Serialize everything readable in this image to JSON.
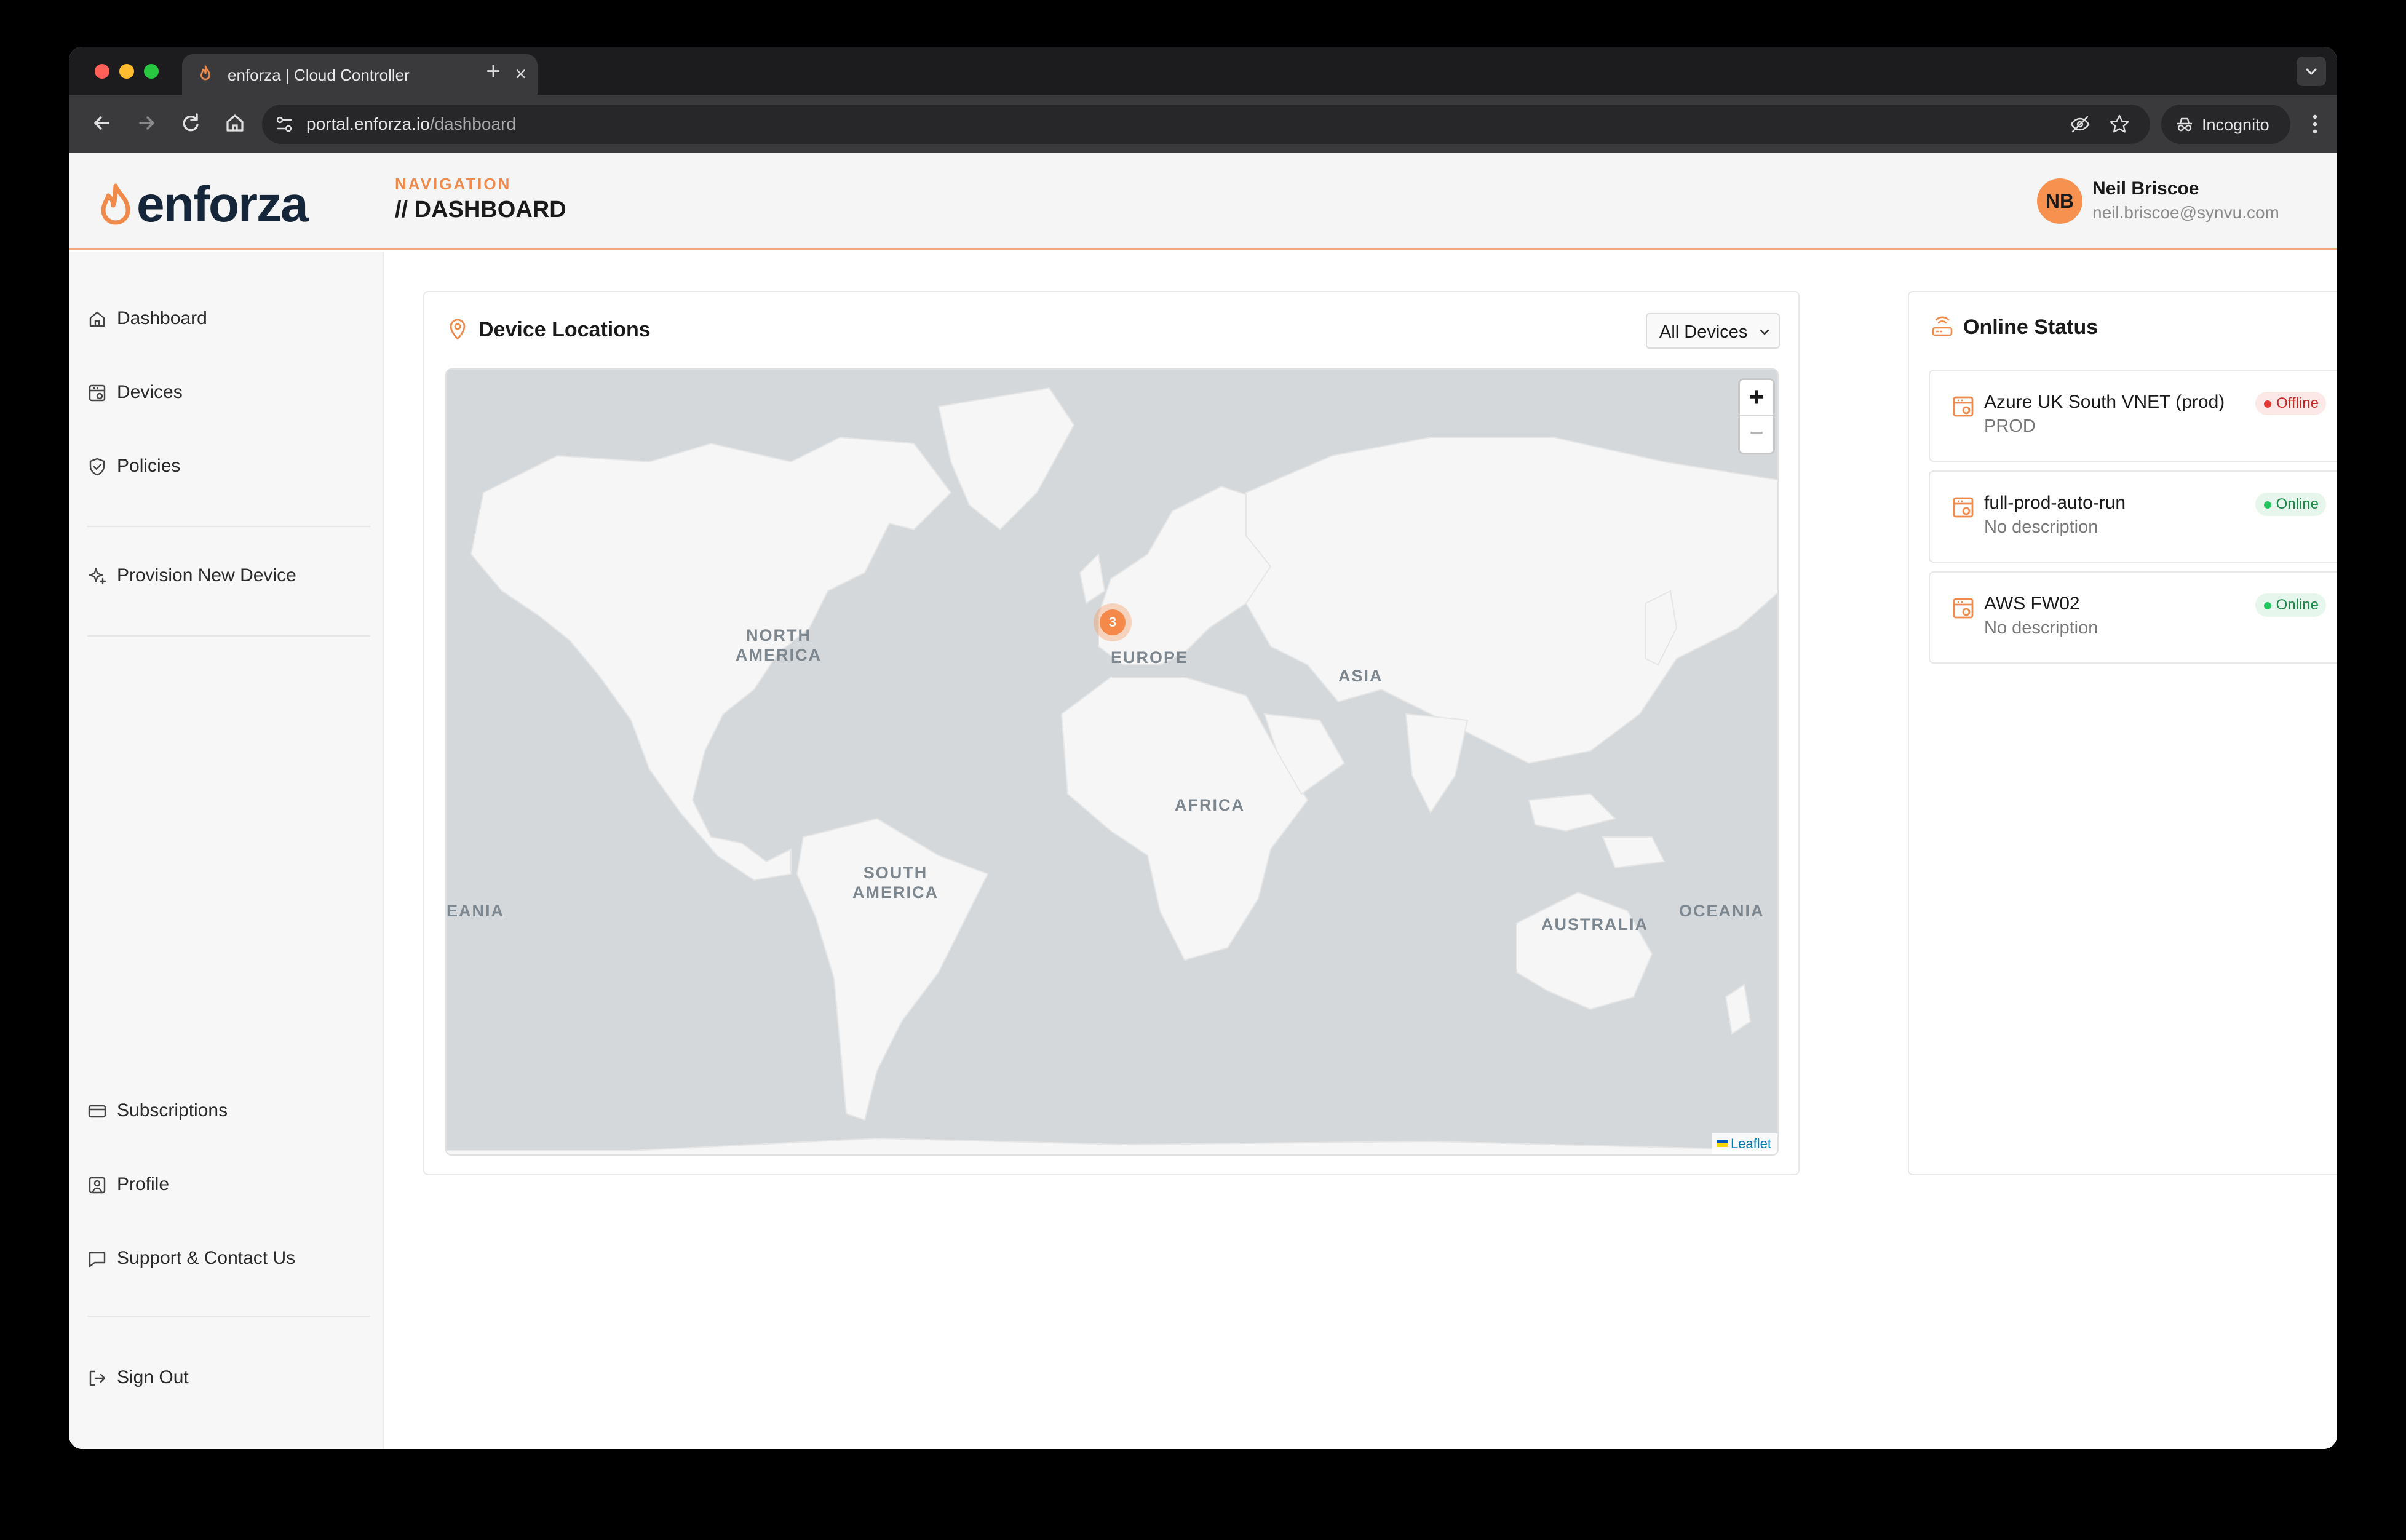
{
  "browser": {
    "tab_title": "enforza | Cloud Controller",
    "url_host": "portal.enforza.io",
    "url_path": "/dashboard",
    "incognito_label": "Incognito"
  },
  "header": {
    "logo_text": "enforza",
    "nav_label": "NAVIGATION",
    "nav_title": "// DASHBOARD",
    "user": {
      "initials": "NB",
      "name": "Neil Briscoe",
      "email": "neil.briscoe@synvu.com"
    }
  },
  "sidebar": {
    "top_items": [
      {
        "label": "Dashboard",
        "icon": "home-icon"
      },
      {
        "label": "Devices",
        "icon": "device-icon"
      },
      {
        "label": "Policies",
        "icon": "shield-icon"
      }
    ],
    "action_item": {
      "label": "Provision New Device",
      "icon": "sparkle-icon"
    },
    "bottom_items": [
      {
        "label": "Subscriptions",
        "icon": "credit-card-icon"
      },
      {
        "label": "Profile",
        "icon": "profile-icon"
      },
      {
        "label": "Support & Contact Us",
        "icon": "chat-icon"
      }
    ],
    "sign_out": {
      "label": "Sign Out",
      "icon": "sign-out-icon"
    }
  },
  "map_card": {
    "title": "Device Locations",
    "filter_value": "All Devices",
    "zoom_in": "+",
    "zoom_out": "−",
    "attribution": "Leaflet",
    "cluster_count": "3",
    "regions": {
      "north_america": [
        "NORTH",
        "AMERICA"
      ],
      "europe": "EUROPE",
      "asia": "ASIA",
      "africa": "AFRICA",
      "south_america": [
        "SOUTH",
        "AMERICA"
      ],
      "australia": "AUSTRALIA",
      "oceania_left": "EANIA",
      "oceania_right": "OCEANIA"
    }
  },
  "status_card": {
    "title": "Online Status",
    "devices": [
      {
        "name": "Azure UK South VNET (prod)",
        "description": "PROD",
        "status": "Offline"
      },
      {
        "name": "full-prod-auto-run",
        "description": "No description",
        "status": "Online"
      },
      {
        "name": "AWS FW02",
        "description": "No description",
        "status": "Online"
      }
    ]
  },
  "colors": {
    "brand_orange": "#f08a4b",
    "brand_navy": "#16263a",
    "offline": "#e53935",
    "online": "#22c55e"
  }
}
